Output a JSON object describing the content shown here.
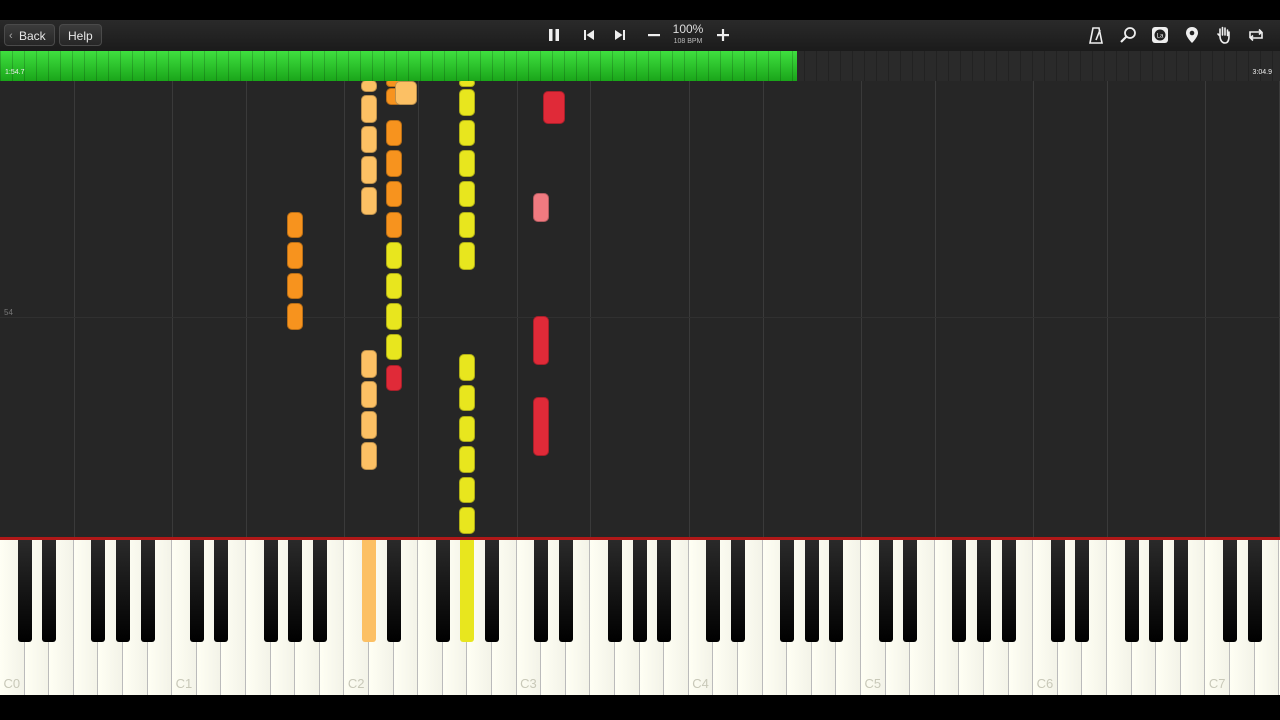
{
  "toolbar": {
    "back_label": "Back",
    "help_label": "Help",
    "speed_percent": "100%",
    "speed_bpm": "108 BPM"
  },
  "progress": {
    "current_time": "1:54.7",
    "total_time": "3:04.9",
    "fraction": 0.623
  },
  "roll": {
    "measure_number": "54",
    "notes": [
      {
        "key": "Ds2",
        "color": "orange",
        "start": -0.2,
        "end": 0.4
      },
      {
        "key": "Ds2",
        "color": "orange",
        "start": 0.7,
        "end": 2.4
      },
      {
        "key": "Ds2",
        "color": "orange",
        "start": 3.8,
        "end": 6.4
      },
      {
        "key": "Ds2",
        "color": "orange",
        "start": 6.8,
        "end": 9.4
      },
      {
        "key": "Ds2",
        "color": "orange",
        "start": 9.8,
        "end": 12.4
      },
      {
        "key": "Ds2",
        "color": "orange",
        "start": 12.8,
        "end": 15.4
      },
      {
        "key": "E2",
        "color": "orange-light",
        "start": 0,
        "end": 2.4
      },
      {
        "key": "Gs2",
        "color": "yellow",
        "start": -0.2,
        "end": 0.4
      },
      {
        "key": "Gs2",
        "color": "yellow",
        "start": 0.8,
        "end": 3.4
      },
      {
        "key": "Gs2",
        "color": "yellow",
        "start": 3.8,
        "end": 6.4
      },
      {
        "key": "Gs2",
        "color": "yellow",
        "start": 6.8,
        "end": 9.4
      },
      {
        "key": "Gs2",
        "color": "yellow",
        "start": 9.8,
        "end": 12.4
      },
      {
        "key": "Gs2",
        "color": "yellow",
        "start": 12.8,
        "end": 15.4
      },
      {
        "key": "Gs2",
        "color": "yellow",
        "start": 15.8,
        "end": 18.5
      },
      {
        "key": "Gs1",
        "color": "orange",
        "start": 12.8,
        "end": 15.4
      },
      {
        "key": "Gs1",
        "color": "orange",
        "start": 15.8,
        "end": 18.4
      },
      {
        "key": "Gs1",
        "color": "orange",
        "start": 18.8,
        "end": 21.4
      },
      {
        "key": "Gs1",
        "color": "orange",
        "start": 21.8,
        "end": 24.4
      },
      {
        "key": "Cs2",
        "color": "orange-light",
        "start": -0.1,
        "end": 1.1
      },
      {
        "key": "Cs2",
        "color": "orange-light",
        "start": 1.4,
        "end": 4.1
      },
      {
        "key": "Cs2",
        "color": "orange-light",
        "start": 4.4,
        "end": 7.1
      },
      {
        "key": "Cs2",
        "color": "orange-light",
        "start": 7.4,
        "end": 10.1
      },
      {
        "key": "Cs2",
        "color": "orange-light",
        "start": 10.4,
        "end": 13.1
      },
      {
        "key": "Cs2",
        "color": "orange-light",
        "start": 26.4,
        "end": 29.1
      },
      {
        "key": "Cs2",
        "color": "orange-light",
        "start": 29.4,
        "end": 32.1
      },
      {
        "key": "Cs2",
        "color": "orange-light",
        "start": 32.4,
        "end": 35.1
      },
      {
        "key": "Cs2",
        "color": "orange-light",
        "start": 35.4,
        "end": 38.1
      },
      {
        "key": "Ds2",
        "color": "yellow",
        "start": 15.8,
        "end": 18.4
      },
      {
        "key": "Ds2",
        "color": "yellow",
        "start": 18.8,
        "end": 21.4
      },
      {
        "key": "Ds2",
        "color": "yellow",
        "start": 21.8,
        "end": 24.4
      },
      {
        "key": "Ds2",
        "color": "yellow",
        "start": 24.8,
        "end": 27.4
      },
      {
        "key": "Ds2",
        "color": "red",
        "start": 27.8,
        "end": 30.4
      },
      {
        "key": "Gs2",
        "color": "yellow",
        "start": 26.8,
        "end": 29.4
      },
      {
        "key": "Gs2",
        "color": "yellow",
        "start": 29.8,
        "end": 32.4
      },
      {
        "key": "Gs2",
        "color": "yellow",
        "start": 32.8,
        "end": 35.4
      },
      {
        "key": "Gs2",
        "color": "yellow",
        "start": 35.8,
        "end": 38.4
      },
      {
        "key": "Gs2",
        "color": "yellow",
        "start": 38.8,
        "end": 41.4
      },
      {
        "key": "Gs2",
        "color": "yellow",
        "start": 41.8,
        "end": 44.4
      },
      {
        "key": "D3",
        "color": "red",
        "start": 1.0,
        "end": 4.2
      },
      {
        "key": "Cs3",
        "color": "pink",
        "start": 11.0,
        "end": 13.8
      },
      {
        "key": "Cs3",
        "color": "red",
        "start": 23.0,
        "end": 27.8
      },
      {
        "key": "Cs3",
        "color": "red",
        "start": 31.0,
        "end": 36.8
      }
    ],
    "active_keys": [
      {
        "key": "Cs2",
        "color": "orange-light"
      },
      {
        "key": "Gs2",
        "color": "yellow"
      }
    ]
  },
  "keyboard": {
    "octave_labels": [
      "C0",
      "C1",
      "C2",
      "C3",
      "C4",
      "C5",
      "C6",
      "C7"
    ]
  },
  "colors": {
    "orange": "#f7931e",
    "orange-light": "#fcc064",
    "yellow": "#e8e61e",
    "red": "#e02a38",
    "pink": "#f07a80",
    "progress": "#2fcf2f"
  },
  "icons": [
    "pause-icon",
    "skip-back-icon",
    "skip-forward-icon",
    "minus-icon",
    "plus-icon",
    "metronome-icon",
    "magnifier-icon",
    "label-icon",
    "location-pin-icon",
    "hand-icon",
    "loop-icon"
  ]
}
